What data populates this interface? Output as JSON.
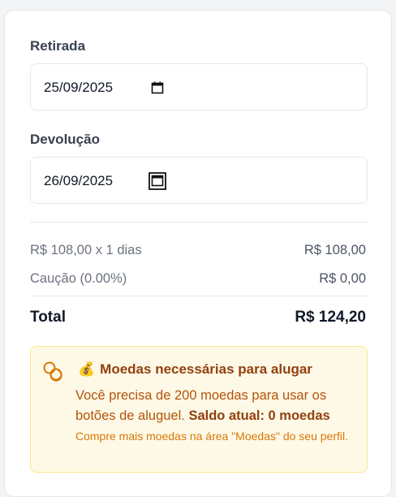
{
  "pickup": {
    "label": "Retirada",
    "value": "25/09/2025"
  },
  "return": {
    "label": "Devolução",
    "value": "26/09/2025"
  },
  "summary": {
    "rental_line": "R$ 108,00 x 1 dias",
    "rental_amount": "R$ 108,00",
    "deposit_line": "Caução (0.00%)",
    "deposit_amount": "R$ 0,00",
    "total_label": "Total",
    "total_amount": "R$ 124,20"
  },
  "coins_alert": {
    "bag_emoji": "💰",
    "title": "Moedas necessárias para alugar",
    "body_text": "Você precisa de 200 moedas para usar os botões de aluguel. ",
    "balance_text": "Saldo atual: 0 moedas",
    "note": "Compre mais moedas na área \"Moedas\" do seu perfil."
  },
  "colors": {
    "alert_background": "#fef9e7",
    "alert_border": "#fde68a",
    "alert_title": "#92400e",
    "alert_text": "#b45309"
  },
  "icons": {
    "calendar": "calendar-icon",
    "coins": "coins-icon"
  }
}
